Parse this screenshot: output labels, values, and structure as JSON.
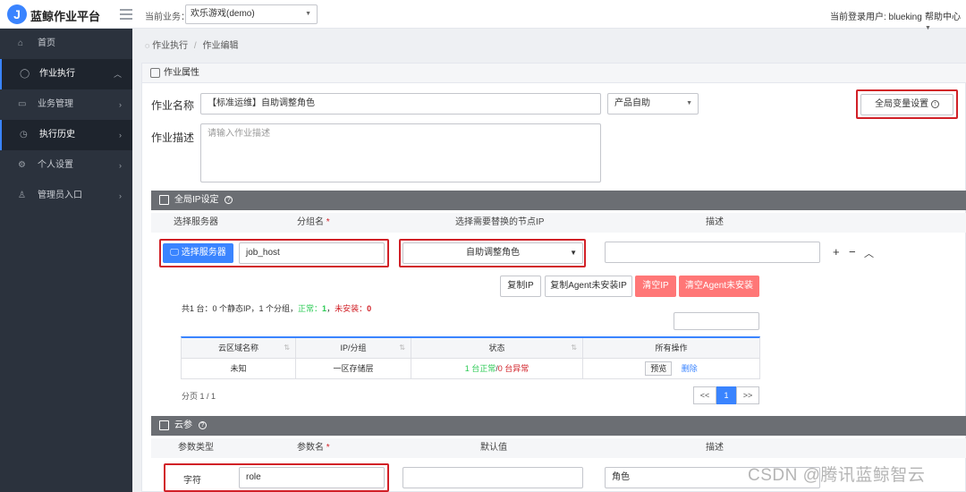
{
  "app": {
    "logo_letter": "J",
    "name": "蓝鲸作业平台"
  },
  "topbar": {
    "business_label": "当前业务：",
    "business_value": "欢乐游戏(demo)",
    "user_text": "当前登录用户: blueking",
    "help_label": "帮助中心"
  },
  "sidebar": {
    "items": [
      {
        "label": "首页",
        "icon": "home-icon"
      },
      {
        "label": "作业执行",
        "icon": "circle-icon"
      },
      {
        "label": "业务管理",
        "icon": "briefcase-icon"
      },
      {
        "label": "执行历史",
        "icon": "clock-icon"
      },
      {
        "label": "个人设置",
        "icon": "gear-icon"
      },
      {
        "label": "管理员入口",
        "icon": "user-icon"
      }
    ]
  },
  "breadcrumb": {
    "first": "作业执行",
    "separator": "/",
    "second": "作业编辑"
  },
  "job": {
    "section_title": "作业属性",
    "name_label": "作业名称",
    "name_value": "【标准运维】自助调整角色",
    "category_value": "产品自助",
    "global_var_button": "全局变量设置",
    "desc_label": "作业描述",
    "desc_placeholder": "请输入作业描述"
  },
  "global_ip": {
    "title": "全局IP设定",
    "headers": [
      "选择服务器",
      "分组名",
      "选择需要替换的节点IP",
      "描述"
    ],
    "required_mark": "*",
    "select_server_button": "选择服务器",
    "group_name": "job_host",
    "node_select": "自助调整角色",
    "copy_ip": "复制IP",
    "copy_agent_ip": "复制Agent未安装IP",
    "clear_ip": "清空IP",
    "clear_agent": "清空Agent未安装",
    "summary_prefix": "共1 台：0 个静态IP，1 个分组，",
    "summary_normal_label": "正常：",
    "summary_normal_value": "1",
    "summary_sep": "，",
    "summary_uninstalled_label": "未安装：",
    "summary_uninstalled_value": "0",
    "table_headers": [
      "云区域名称",
      "IP/分组",
      "状态",
      "所有操作"
    ],
    "row": {
      "area": "未知",
      "group": "一区存储层",
      "status_normal": "1 台正常",
      "status_sep": "/",
      "status_abnormal": "0 台异常",
      "preview": "预览",
      "delete": "删除"
    },
    "pagination_text": "分页 1 / 1",
    "prev": "<<",
    "page": "1",
    "next": ">>"
  },
  "cloud_params": {
    "title": "云参",
    "headers": [
      "参数类型",
      "参数名",
      "默认值",
      "描述"
    ],
    "type_value": "字符",
    "name_value": "role",
    "desc_value": "角色"
  },
  "watermark": "CSDN @腾讯蓝鲸智云",
  "colors": {
    "accent": "#3a84ff",
    "danger": "#ff5656",
    "highlight": "#d12027",
    "sidebar": "#2b323d"
  }
}
